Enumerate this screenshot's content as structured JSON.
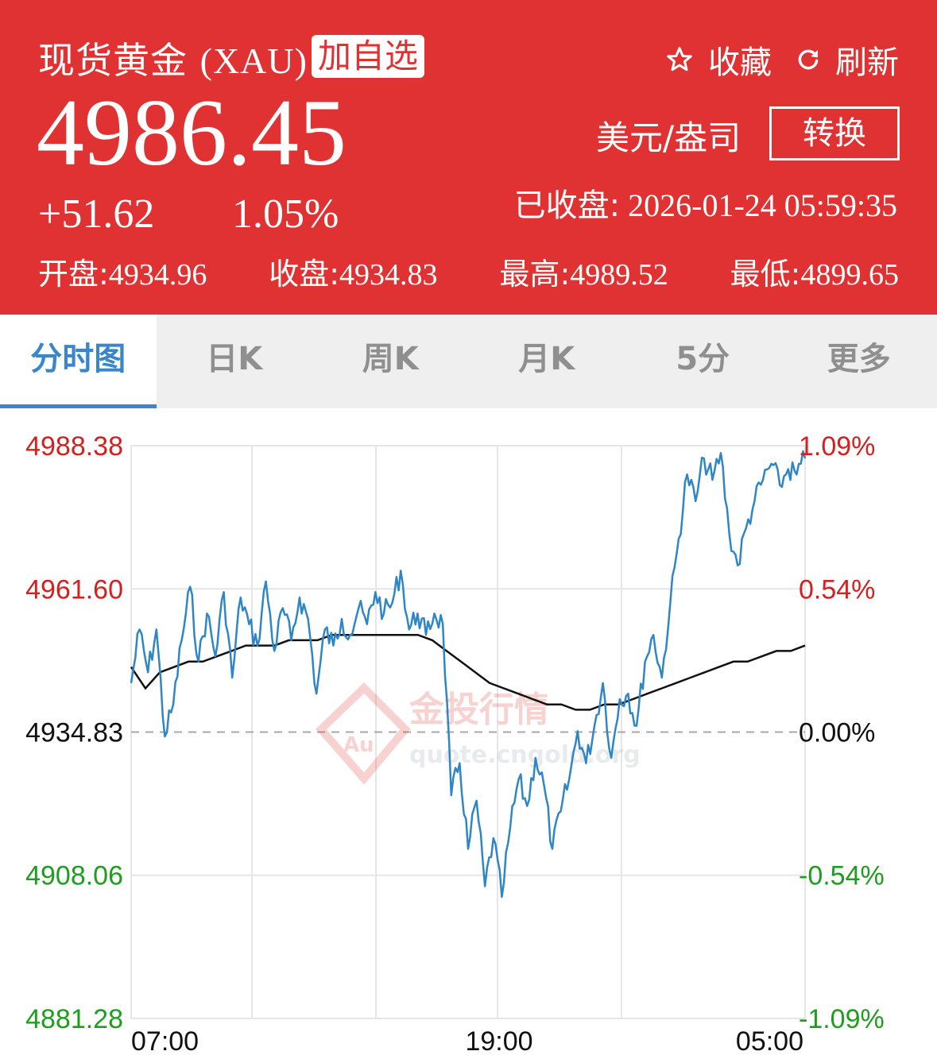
{
  "header": {
    "title": "现货黄金",
    "code": "(XAU)",
    "add_watch": "加自选",
    "favorite": "收藏",
    "refresh": "刷新",
    "price": "4986.45",
    "change": "+51.62",
    "change_pct": "1.05%",
    "unit": "美元/盎司",
    "convert": "转换",
    "status_label": "已收盘:",
    "status_time": "2026-01-24 05:59:35",
    "open_label": "开盘:",
    "open": "4934.96",
    "close_label": "收盘:",
    "close": "4934.83",
    "high_label": "最高:",
    "high": "4989.52",
    "low_label": "最低:",
    "low": "4899.65",
    "bg_color": "#e03232"
  },
  "tabs": [
    "分时图",
    "日K",
    "周K",
    "月K",
    "5分",
    "更多"
  ],
  "active_tab": 0,
  "chart_data": {
    "type": "line",
    "watermark": [
      "金投行情",
      "quote.cngold.org",
      "Au"
    ],
    "x_ticks": [
      "07:00",
      "19:00",
      "05:00"
    ],
    "y_left_ticks": [
      "4988.38",
      "4961.60",
      "4934.83",
      "4908.06",
      "4881.28"
    ],
    "y_right_ticks": [
      "1.09%",
      "0.54%",
      "0.00%",
      "-0.54%",
      "-1.09%"
    ],
    "ylim": [
      4881.28,
      4988.38
    ],
    "baseline": 4934.83,
    "colors": {
      "price": "#2f86c6",
      "average": "#111111",
      "up": "#d61f1f",
      "flat": "#111111",
      "down": "#1e9e1e"
    },
    "series": [
      {
        "values": [
          4944,
          4954,
          4946,
          4954,
          4934,
          4940,
          4952,
          4962,
          4948,
          4957,
          4949,
          4961,
          4945,
          4960,
          4955,
          4951,
          4963,
          4950,
          4958,
          4952,
          4960,
          4956,
          4942,
          4954,
          4951,
          4956,
          4953,
          4958,
          4955,
          4961,
          4957,
          4959,
          4965,
          4954,
          4957,
          4953,
          4957,
          4955,
          4923,
          4929,
          4913,
          4922,
          4906,
          4915,
          4904,
          4917,
          4926,
          4921,
          4930,
          4925,
          4913,
          4920,
          4926,
          4935,
          4929,
          4936,
          4944,
          4930,
          4941,
          4942,
          4936,
          4948,
          4953,
          4945,
          4959,
          4971,
          4983,
          4978,
          4986,
          4982,
          4987,
          4972,
          4966,
          4973,
          4978,
          4982,
          4985,
          4981,
          4984,
          4983,
          4986
        ]
      },
      {
        "values": [
          4947,
          4943,
          4946,
          4947,
          4948,
          4948,
          4949,
          4950,
          4951,
          4951,
          4951,
          4952,
          4952,
          4952,
          4953,
          4953,
          4953,
          4953,
          4953,
          4953,
          4953,
          4952,
          4950,
          4948,
          4946,
          4944,
          4943,
          4942,
          4941,
          4940,
          4940,
          4939,
          4939,
          4940,
          4940,
          4941,
          4942,
          4943,
          4944,
          4945,
          4946,
          4947,
          4948,
          4948,
          4949,
          4950,
          4950,
          4951
        ]
      }
    ]
  }
}
